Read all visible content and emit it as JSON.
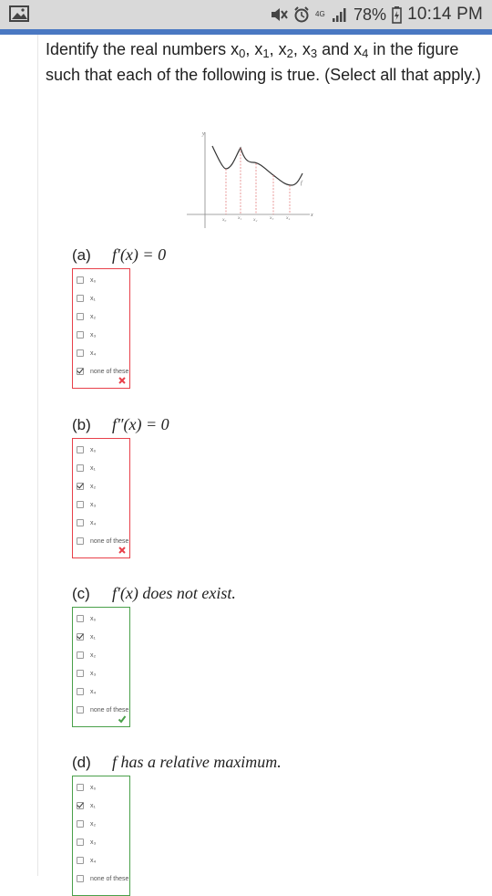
{
  "status_bar": {
    "battery_percent": "78%",
    "time": "10:14 PM",
    "network_label": "4G"
  },
  "question": {
    "text_before": "Identify the real numbers ",
    "vars": [
      "x",
      "x",
      "x",
      "x"
    ],
    "subs": [
      "0",
      "1",
      "2",
      "3",
      "4"
    ],
    "text_after": " in the figure such that each of the following is true. (Select all that apply.)",
    "sep_and": " and "
  },
  "figure": {
    "axis_y_label": "y",
    "axis_x_label": "x",
    "curve_label": "f",
    "tick_labels": [
      "x₀",
      "x₁",
      "x₂",
      "x₃",
      "x₄"
    ]
  },
  "parts": [
    {
      "letter": "(a)",
      "statement": "f′(x) = 0",
      "options": [
        "x₀",
        "x₁",
        "x₂",
        "x₃",
        "x₄",
        "none of these"
      ],
      "checked": [
        false,
        false,
        false,
        false,
        false,
        true
      ],
      "result": "wrong"
    },
    {
      "letter": "(b)",
      "statement": "f″(x) = 0",
      "options": [
        "x₀",
        "x₁",
        "x₂",
        "x₃",
        "x₄",
        "none of these"
      ],
      "checked": [
        false,
        false,
        true,
        false,
        false,
        false
      ],
      "result": "wrong"
    },
    {
      "letter": "(c)",
      "statement": "f′(x) does not exist.",
      "options": [
        "x₀",
        "x₁",
        "x₂",
        "x₃",
        "x₄",
        "none of these"
      ],
      "checked": [
        false,
        true,
        false,
        false,
        false,
        false
      ],
      "result": "right"
    },
    {
      "letter": "(d)",
      "statement": "f has a relative maximum.",
      "options": [
        "x₀",
        "x₁",
        "x₂",
        "x₃",
        "x₄",
        "none of these"
      ],
      "checked": [
        false,
        true,
        false,
        false,
        false,
        false
      ],
      "result": ""
    }
  ]
}
